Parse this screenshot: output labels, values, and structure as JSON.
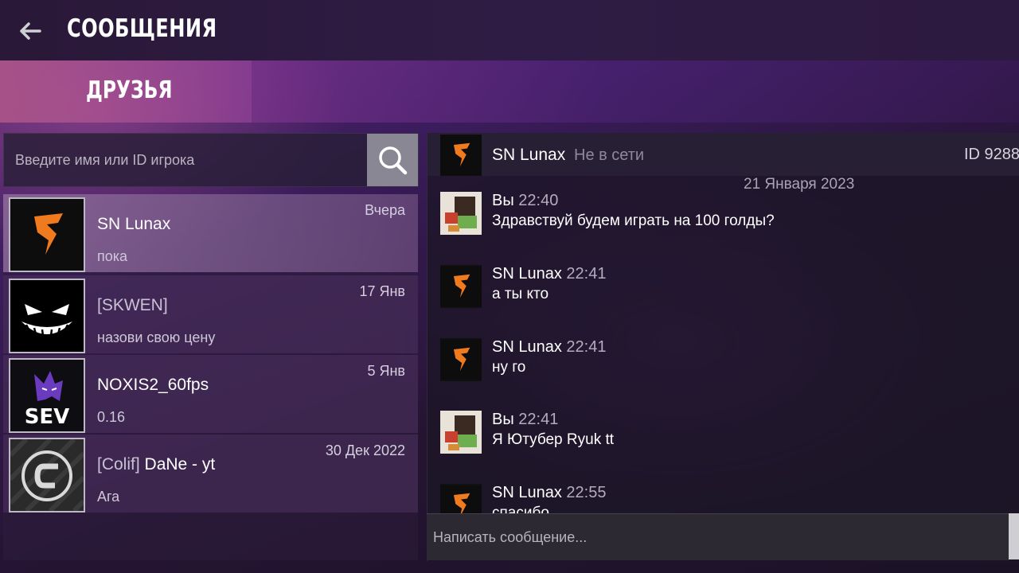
{
  "header": {
    "title": "СООБЩЕНИЯ"
  },
  "tabs": {
    "friends": "ДРУЗЬЯ"
  },
  "search": {
    "placeholder": "Введите имя или ID игрока"
  },
  "friends": [
    {
      "name": "SN Lunax",
      "clan": "",
      "last_message": "пока",
      "date": "Вчера",
      "avatar": "orange-s-logo",
      "active": true
    },
    {
      "name": "",
      "clan": "[SKWEN]",
      "last_message": "назови свою цену",
      "date": "17 Янв",
      "avatar": "grin-face-logo",
      "active": false
    },
    {
      "name": "NOXIS2_60fps",
      "clan": "",
      "last_message": "0.16",
      "date": "5 Янв",
      "avatar": "sev-wolf-logo",
      "active": false
    },
    {
      "name": "DaNe - yt",
      "clan": "[Colif]",
      "last_message": "Ага",
      "date": "30 Дек 2022",
      "avatar": "c-circle-logo",
      "active": false
    }
  ],
  "chat": {
    "contact_name": "SN Lunax",
    "contact_status": "Не в сети",
    "contact_id": "ID 9288",
    "date_separator": "21 Января 2023",
    "messages": [
      {
        "author": "Вы",
        "time": "22:40",
        "text": "Здравствуй будем играть на 100 голды?",
        "avatar": "blocky-character-avatar"
      },
      {
        "author": "SN Lunax",
        "time": "22:41",
        "text": "а ты кто",
        "avatar": "orange-s-logo"
      },
      {
        "author": "SN Lunax",
        "time": "22:41",
        "text": "ну го",
        "avatar": "orange-s-logo"
      },
      {
        "author": "Вы",
        "time": "22:41",
        "text": "Я Ютубер Ryuk tt",
        "avatar": "blocky-character-avatar"
      },
      {
        "author": "SN Lunax",
        "time": "22:55",
        "text": "спасибо",
        "avatar": "orange-s-logo"
      }
    ],
    "composer_placeholder": "Написать сообщение..."
  },
  "colors": {
    "accent_orange": "#f07a1e",
    "search_button": "#8a8794"
  }
}
